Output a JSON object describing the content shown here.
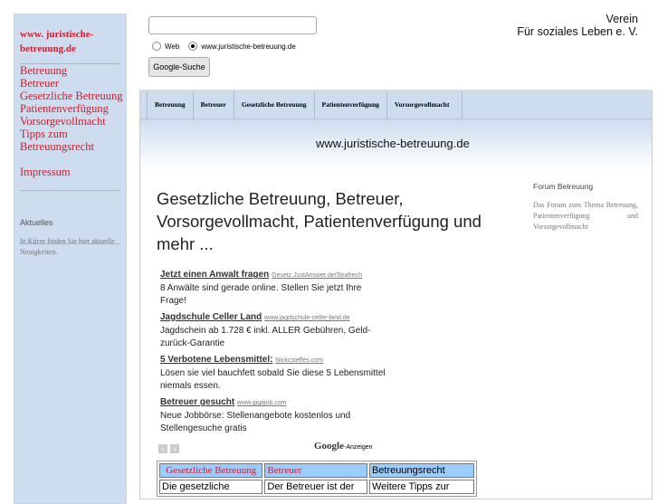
{
  "sidebar": {
    "site": "www. juristische-betreuung.de",
    "nav": [
      "Betreuung",
      "Betreuer",
      "Gesetzliche Betreuung",
      "Patientenverfügung",
      "Vorsorgevollmacht",
      "Tipps zum Betreuungsrecht"
    ],
    "impressum": "Impressum",
    "news_title": "Aktuelles",
    "news_text": "In Kürze finden Sie hier aktuelle Neuigkeiten."
  },
  "search": {
    "value": "",
    "radio_web": "Web",
    "radio_site": "www.juristische-betreuung.de",
    "button": "Google-Suche"
  },
  "org": {
    "line1": "Verein",
    "line2": "Für soziales Leben e. V."
  },
  "topnav": [
    "Betreuung",
    "Betreuer",
    "Gesetzliche Betreuung",
    "Patientenverfügung",
    "Vorsorgevollmacht"
  ],
  "banner": "www.juristische-betreuung.de",
  "title": "Gesetzliche Betreuung, Betreuer, Vorsorgevollmacht, Patientenverfügung und mehr ...",
  "forum": {
    "title": "Forum Betreuung",
    "text": "Das Forum zum Thema Betreuung, Patientenverfügung und Vorsorgevollmacht"
  },
  "ads": [
    {
      "title": "Jetzt einen Anwalt fragen",
      "url": "Gesetz.JustAnswer.de/Strafrech",
      "text": "8 Anwälte sind gerade online. Stellen Sie jetzt Ihre Frage!"
    },
    {
      "title": "Jagdschule Celler Land",
      "url": "www.jagdschule-celler-land.de",
      "text": "Jagdschein ab 1.728 € inkl. ALLER Gebühren, Geld-zurück-Garantie"
    },
    {
      "title": "5 Verbotene Lebensmittel:",
      "url": "Nickcsteffes.com",
      "text": "Lösen sie viel bauchfett sobald Sie diese 5 Lebensmittel niemals essen."
    },
    {
      "title": "Betreuer gesucht",
      "url": "www.gigajob.com",
      "text": "Neue Jobbörse: Stellenangebote kostenlos und Stellengesuche gratis"
    }
  ],
  "ads_footer": {
    "brand": "Google",
    "label": "-Anzeigen"
  },
  "table": {
    "headers": [
      "Gesetzliche Betreuung",
      "Betreuer",
      "Betreuungsrecht"
    ],
    "row": [
      "Die gesetzliche",
      "Der Betreuer ist der",
      "Weitere Tipps zur"
    ]
  }
}
